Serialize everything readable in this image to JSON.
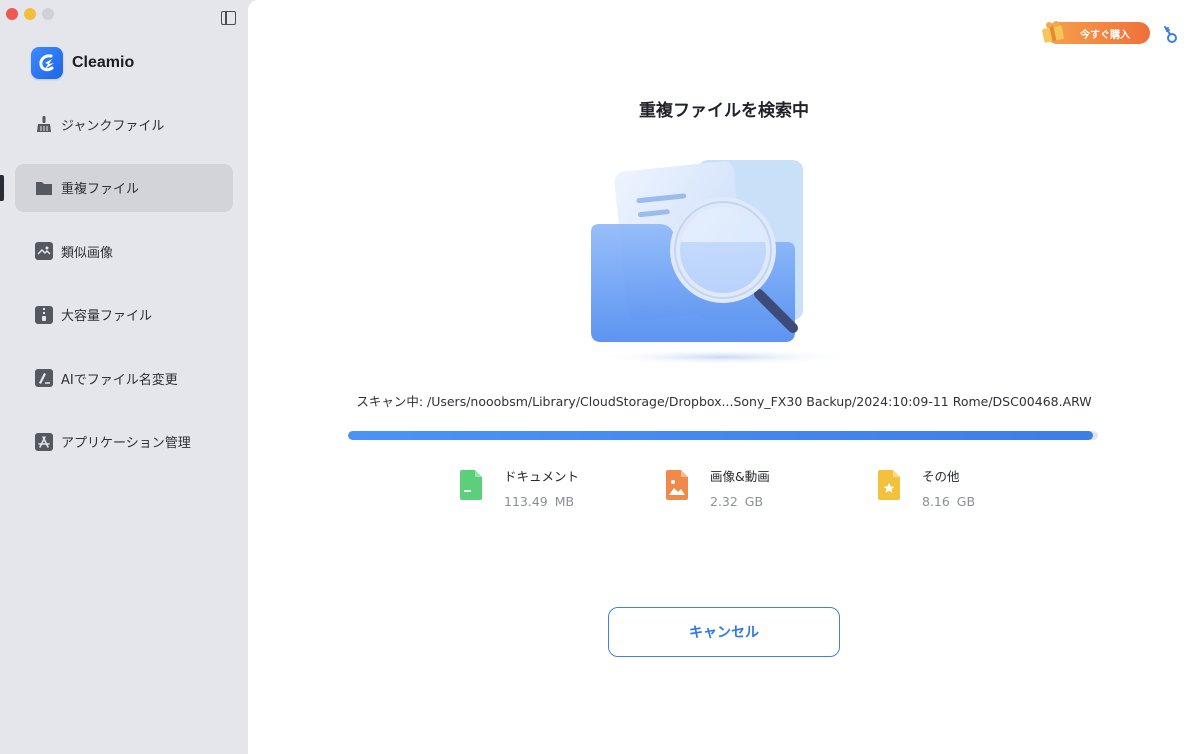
{
  "app": {
    "name": "Cleamio"
  },
  "sidebar": {
    "items": [
      {
        "label": "ジャンクファイル",
        "icon": "broom-icon",
        "active": false
      },
      {
        "label": "重複ファイル",
        "icon": "folder-icon",
        "active": true
      },
      {
        "label": "類似画像",
        "icon": "image-icon",
        "active": false
      },
      {
        "label": "大容量ファイル",
        "icon": "zip-file-icon",
        "active": false
      },
      {
        "label": "AIでファイル名変更",
        "icon": "ai-rename-icon",
        "active": false
      },
      {
        "label": "アプリケーション管理",
        "icon": "app-store-icon",
        "active": false
      }
    ]
  },
  "header": {
    "buy_label": "今すぐ購入"
  },
  "main": {
    "title": "重複ファイルを検索中",
    "scan_path": "スキャン中: /Users/nooobsm/Library/CloudStorage/Dropbox...Sony_FX30 Backup/2024:10:09-11 Rome/DSC00468.ARW",
    "progress_fraction": 0.993,
    "stats": [
      {
        "label": "ドキュメント",
        "value": "113.49 MB",
        "icon": "document-icon",
        "color": "#5ccf7a"
      },
      {
        "label": "画像&動画",
        "value": "2.32 GB",
        "icon": "photo-video-icon",
        "color": "#f08a4b"
      },
      {
        "label": "その他",
        "value": "8.16 GB",
        "icon": "other-file-icon",
        "color": "#f2c23e"
      }
    ],
    "cancel_label": "キャンセル"
  },
  "colors": {
    "accent": "#3d83e8",
    "buy": "#f0703a",
    "sidebar": "#e4e6ec"
  }
}
